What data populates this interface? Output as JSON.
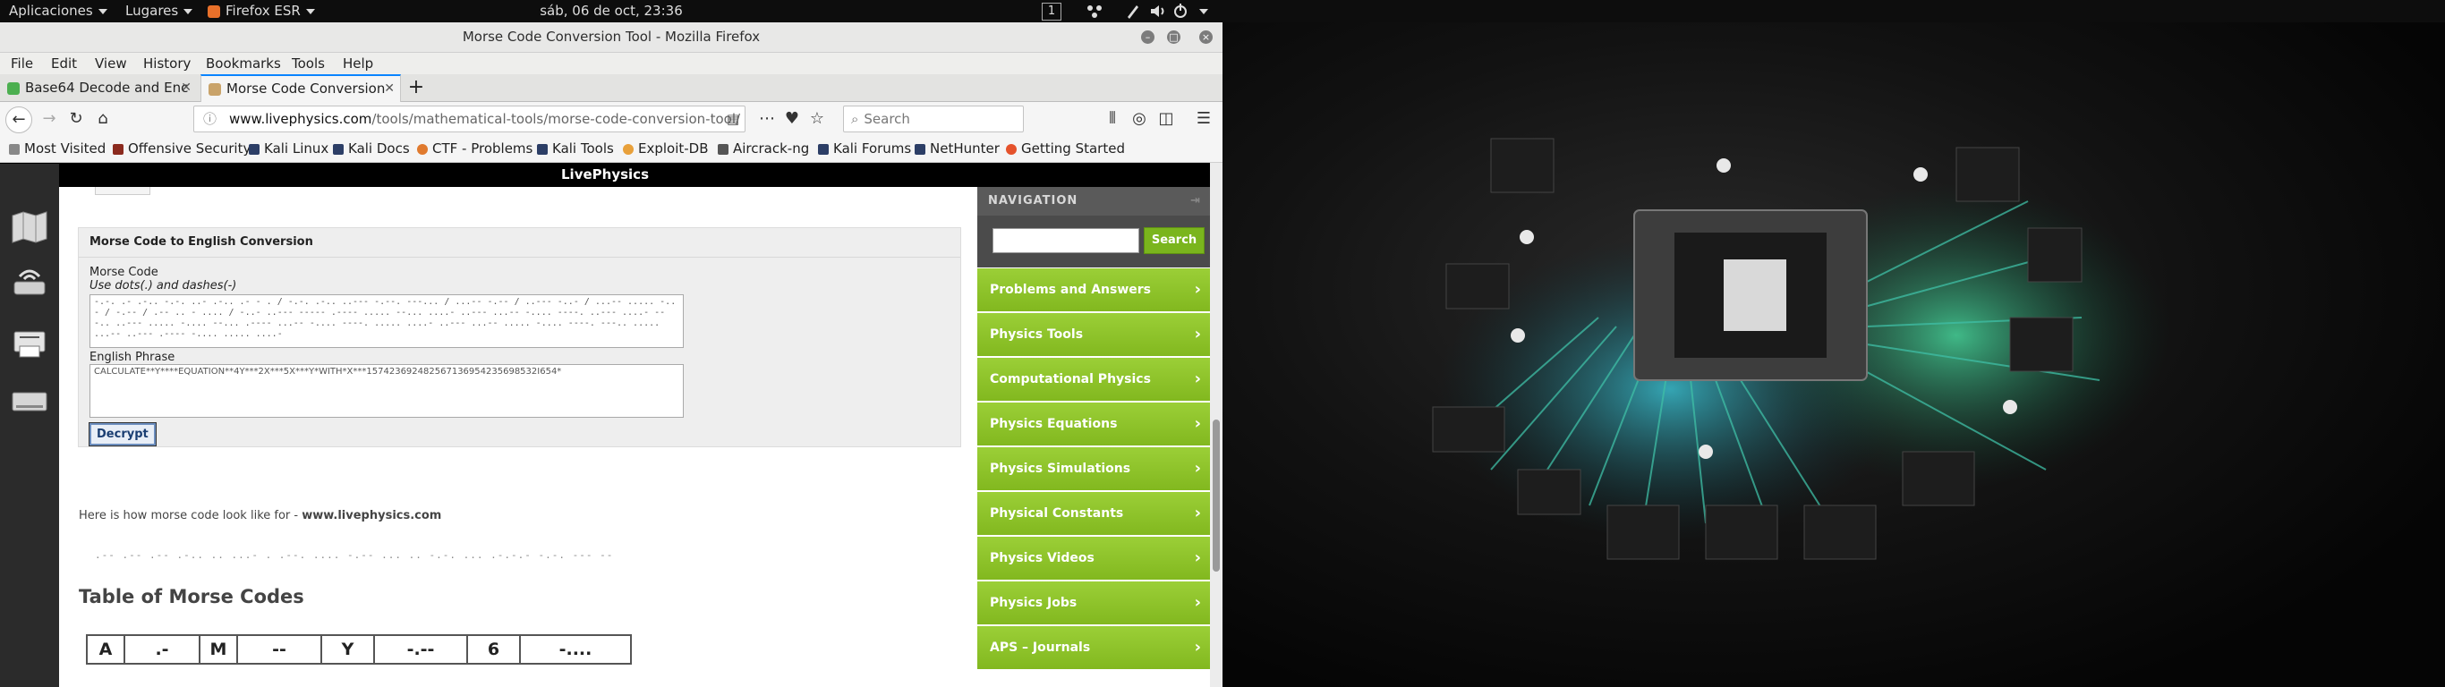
{
  "topbar": {
    "apps_label": "Aplicaciones",
    "places_label": "Lugares",
    "firefox_label": "Firefox ESR",
    "clock": "sáb, 06 de oct, 23:36",
    "workspace": "1"
  },
  "window": {
    "title": "Morse Code Conversion Tool - Mozilla Firefox"
  },
  "menu": [
    "File",
    "Edit",
    "View",
    "History",
    "Bookmarks",
    "Tools",
    "Help"
  ],
  "tabs": [
    {
      "label": "Base64 Decode and Enc",
      "active": false
    },
    {
      "label": "Morse Code Conversion",
      "active": true
    }
  ],
  "nav": {
    "url_host": "www.livephysics.com",
    "url_path": "/tools/mathematical-tools/morse-code-conversion-tool/",
    "search_placeholder": "Search"
  },
  "bookmarks": [
    "Most Visited",
    "Offensive Security",
    "Kali Linux",
    "Kali Docs",
    "CTF - Problems",
    "Kali Tools",
    "Exploit-DB",
    "Aircrack-ng",
    "Kali Forums",
    "NetHunter",
    "Getting Started"
  ],
  "site": {
    "header": "LivePhysics",
    "panel_title": "Morse Code to English Conversion",
    "morse_label": "Morse Code",
    "morse_hint": "Use dots(.) and dashes(-)",
    "morse_value": "-.-. .- .-.. -.-. ..- .-.. .- - . / -.-. .-.. ..--- -.--. ---... / ...-- -.-- / ..--- -..- / ...-- ..... -..- / -.-- / .-- .. - .... / -..- ..--- ----- .---- ..... --... ....- ..--- ...-- -.... ----. ..--- ....- ---.. ..--- ..... -.... --... .---- ...-- -.... ----. ..... ....- ..--- ...-- ..... -.... ----. ---.. ..... ...-- ..--- .---- -.... ..... ....-",
    "english_label": "English Phrase",
    "english_value": "CALCULATE**Y****EQUATION**4Y***2X***5X***Y*WITH*X***157423692482567136954235698532I654*",
    "decrypt_label": "Decrypt",
    "lookup_prefix": "Here is how morse code look like for - ",
    "lookup_host": "www.livephysics.com",
    "morse_demo": ".-- .-- .-- .-.. .. ...- . .--. .... -.-- ... .. -.-. ... .-.-.- -.-. --- --",
    "table_heading": "Table of Morse Codes",
    "table_row": [
      "A",
      ".-",
      "M",
      "--",
      "Y",
      "-.--",
      "6",
      "-...."
    ],
    "nav_heading": "NAVIGATION",
    "nav_search_button": "Search",
    "nav_items": [
      "Problems and Answers",
      "Physics Tools",
      "Computational Physics",
      "Physics Equations",
      "Physics Simulations",
      "Physical Constants",
      "Physics Videos",
      "Physics Jobs",
      "APS – Journals"
    ]
  },
  "colors": {
    "nav_green": "#8bc12a",
    "site_header": "#000000",
    "accent_blue": "#0a84ff"
  }
}
